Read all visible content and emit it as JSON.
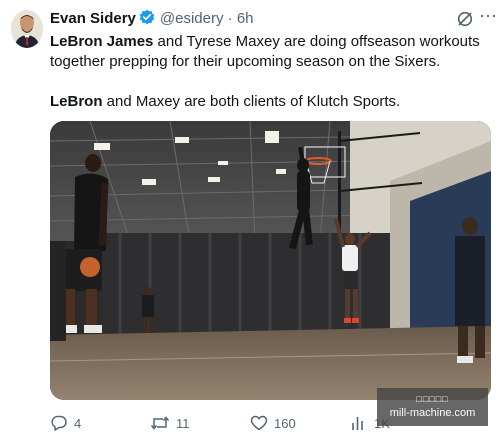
{
  "tweet": {
    "author_name": "Evan Sidery",
    "handle": "@esidery",
    "separator": "·",
    "time": "6h",
    "text_1_bold": "LeBron James",
    "text_1_rest": " and Tyrese Maxey are doing offseason workouts together prepping for their upcoming season on the Sixers.",
    "text_2_bold": "LeBron",
    "text_2_rest": " and Maxey are both clients of Klutch Sports.",
    "media_caption": "",
    "actions": {
      "replies": "4",
      "reposts": "11",
      "likes": "160",
      "views": "1K"
    }
  },
  "icons": {
    "verified": "verified-badge-icon",
    "grok": "grok-icon",
    "more": "more-icon",
    "reply": "reply-icon",
    "repost": "repost-icon",
    "like": "like-icon",
    "views": "views-icon"
  },
  "colors": {
    "verified_blue": "#1d9bf0",
    "secondary_text": "#536471",
    "primary_text": "#0f1419"
  },
  "watermark": {
    "line1": "□□□□□",
    "line2": "mill-machine.com"
  }
}
